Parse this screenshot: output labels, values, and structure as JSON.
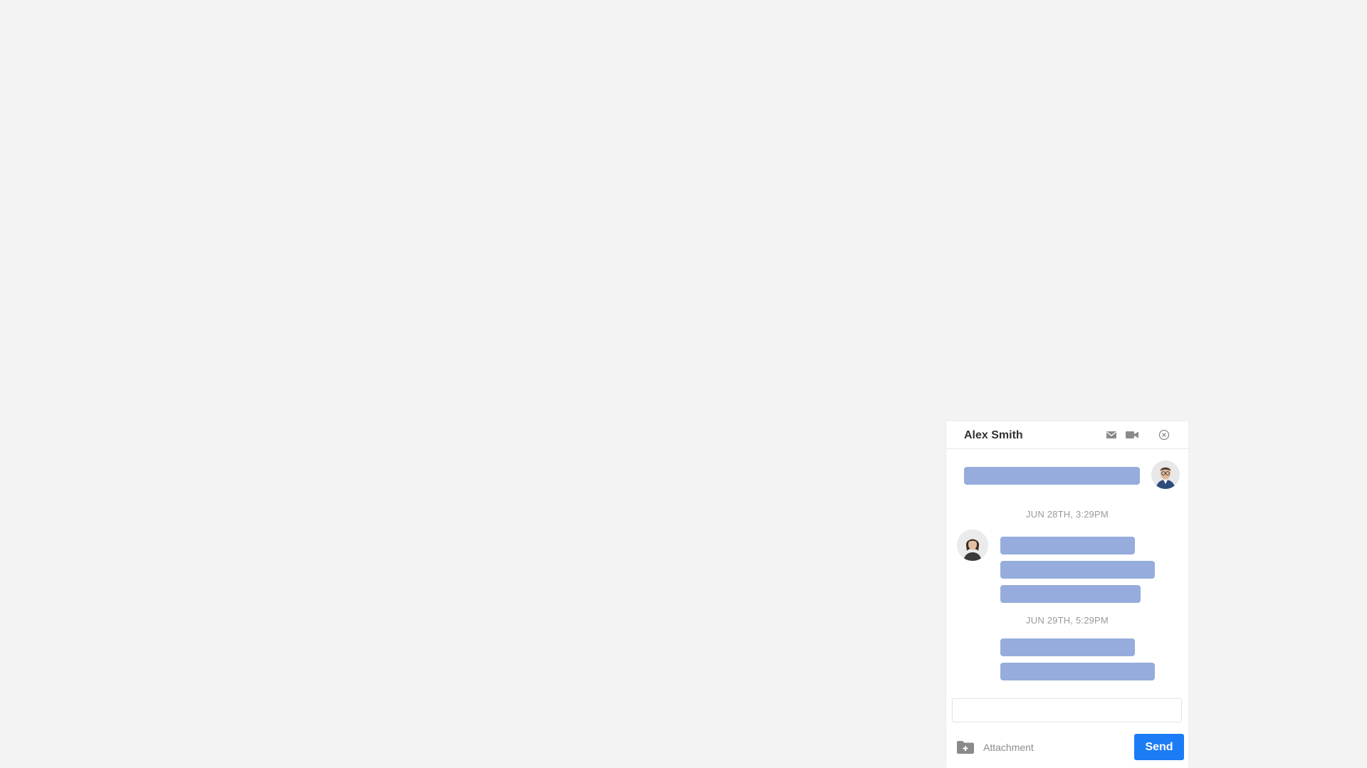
{
  "chat": {
    "contact_name": "Alex Smith",
    "header_icons": [
      "mail-icon",
      "video-icon",
      "close-icon"
    ],
    "timestamps": [
      "JUN 28TH, 3:29PM",
      "JUN 29TH, 5:29PM"
    ],
    "compose": {
      "value": "",
      "placeholder": ""
    },
    "attachment_label": "Attachment",
    "send_label": "Send"
  },
  "colors": {
    "background": "#f3f3f3",
    "bubble": "#95acdc",
    "send_button": "#1c7cf6",
    "icon": "#8a8a8a"
  }
}
